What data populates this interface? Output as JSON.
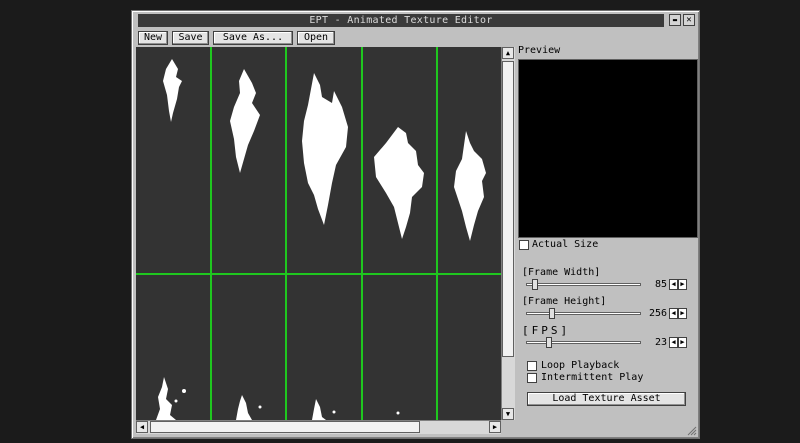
{
  "window": {
    "title": "EPT - Animated Texture Editor",
    "minimize_glyph": "▬",
    "close_glyph": "✕"
  },
  "toolbar": {
    "new_label": "New",
    "save_label": "Save",
    "save_as_label": "Save As...",
    "open_label": "Open"
  },
  "preview": {
    "label": "Preview",
    "actual_size_label": "Actual Size",
    "actual_size_checked": false
  },
  "sliders": [
    {
      "label": "[Frame Width]",
      "value": "85",
      "position": 0.05
    },
    {
      "label": "[Frame Height]",
      "value": "256",
      "position": 0.2
    },
    {
      "label": "[FPS]",
      "value": "23",
      "position": 0.17
    }
  ],
  "options": {
    "loop_label": "Loop Playback",
    "loop_checked": false,
    "intermittent_label": "Intermittent Play",
    "intermittent_checked": false
  },
  "load_button_label": "Load Texture Asset",
  "colors": {
    "grid": "#1fc71f",
    "canvas": "#333333",
    "flame": "#ffffff",
    "titlebar": "#3a3a3a"
  },
  "icons": {
    "up": "▲",
    "down": "▼",
    "left": "◀",
    "right": "▶"
  }
}
